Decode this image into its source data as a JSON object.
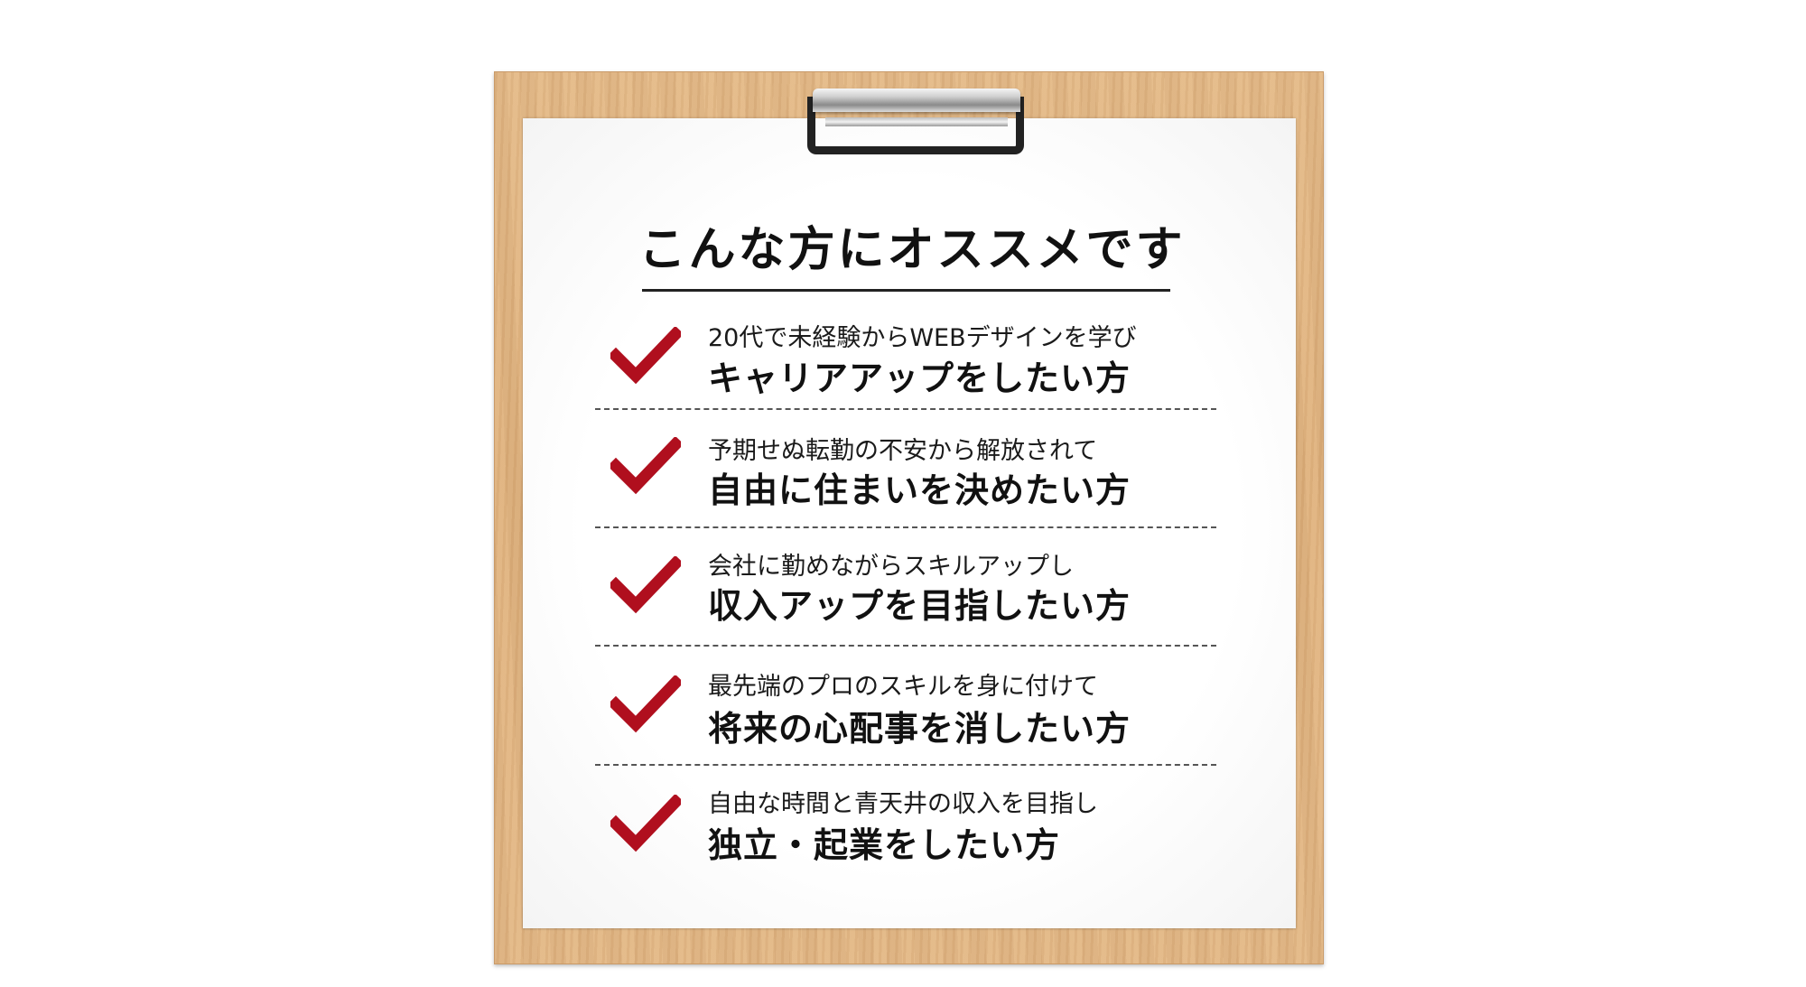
{
  "heading": "こんな方にオススメです",
  "accent_color": "#b00f1e",
  "check_icon": "check-mark",
  "items": [
    {
      "sub": "20代で未経験からWEBデザインを学び",
      "main": "キャリアアップをしたい方"
    },
    {
      "sub": "予期せぬ転勤の不安から解放されて",
      "main": "自由に住まいを決めたい方"
    },
    {
      "sub": "会社に勤めながらスキルアップし",
      "main": "収入アップを目指したい方"
    },
    {
      "sub": "最先端のプロのスキルを身に付けて",
      "main": "将来の心配事を消したい方"
    },
    {
      "sub": "自由な時間と青天井の収入を目指し",
      "main": "独立・起業をしたい方"
    }
  ]
}
